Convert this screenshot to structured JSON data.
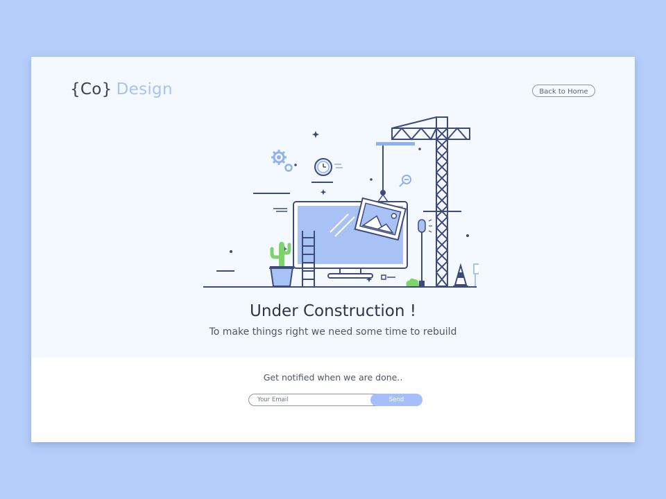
{
  "header": {
    "logo_brand": "{Co}",
    "logo_accent": "Design",
    "back_button_label": "Back to Home"
  },
  "main": {
    "headline": "Under Construction !",
    "subline": "To make things right we need some time to rebuild"
  },
  "signup": {
    "prompt": "Get notified when we are done..",
    "email_placeholder": "Your Email",
    "send_label": "Send"
  },
  "colors": {
    "background": "#b4cdf9",
    "hero": "#f4f8ff",
    "accent": "#a6befa",
    "ink": "#3d4a7a",
    "plant": "#7ed36a"
  }
}
